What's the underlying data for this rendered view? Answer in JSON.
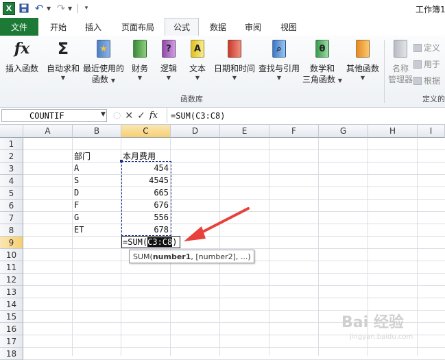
{
  "quick_access": {
    "excel_icon": "X",
    "save_icon": "save-icon",
    "undo_icon": "undo-icon",
    "redo_icon": "redo-icon"
  },
  "window_title": "工作簿1",
  "tabs": [
    {
      "label": "文件"
    },
    {
      "label": "开始"
    },
    {
      "label": "插入"
    },
    {
      "label": "页面布局"
    },
    {
      "label": "公式"
    },
    {
      "label": "数据"
    },
    {
      "label": "审阅"
    },
    {
      "label": "视图"
    }
  ],
  "ribbon": {
    "insert_function": {
      "label": "插入函数",
      "icon": "fx"
    },
    "autosum": {
      "label": "自动求和",
      "icon": "Σ"
    },
    "recent": {
      "line1": "最近使用的",
      "line2": "函数"
    },
    "financial": {
      "label": "财务"
    },
    "logical": {
      "label": "逻辑",
      "glyph": "?"
    },
    "text": {
      "label": "文本",
      "glyph": "A"
    },
    "datetime": {
      "label": "日期和时间"
    },
    "lookup": {
      "label": "查找与引用"
    },
    "math": {
      "line1": "数学和",
      "line2": "三角函数",
      "glyph": "θ"
    },
    "more": {
      "label": "其他函数"
    },
    "group_label": "函数库",
    "name_manager": {
      "line1": "名称",
      "line2": "管理器"
    },
    "define": {
      "label": "定义"
    },
    "use_in": {
      "label": "用于"
    },
    "create": {
      "label": "根据"
    },
    "group2_label": "定义的"
  },
  "formula_bar": {
    "name_box": "COUNTIF",
    "fx": "fx",
    "formula": "=SUM(C3:C8)"
  },
  "columns": [
    "A",
    "B",
    "C",
    "D",
    "E",
    "F",
    "G",
    "H",
    "I"
  ],
  "rows": [
    "1",
    "2",
    "3",
    "4",
    "5",
    "6",
    "7",
    "8",
    "9",
    "10",
    "11",
    "12",
    "13",
    "14",
    "15",
    "16",
    "17",
    "18"
  ],
  "cells": {
    "B2": "部门",
    "C2": "本月费用",
    "B3": "A",
    "C3": "454",
    "B4": "S",
    "C4": "4545",
    "B5": "D",
    "C5": "665",
    "B6": "F",
    "C6": "676",
    "B7": "G",
    "C7": "556",
    "B8": "ET",
    "C8": "678"
  },
  "edit_cell": {
    "prefix": "=SUM(",
    "ref": "C3:C8",
    "suffix": ")"
  },
  "tooltip": {
    "func": "SUM(",
    "arg1": "number1",
    "rest": ", [number2], ...)"
  },
  "watermark": {
    "text": "Bai 经验",
    "url": "jingyan.baidu.com"
  },
  "colors": {
    "file_tab": "#1d7a36",
    "selected_header": "#f6cf72",
    "arrow": "#e8403a",
    "marquee": "#1c2f8a"
  }
}
